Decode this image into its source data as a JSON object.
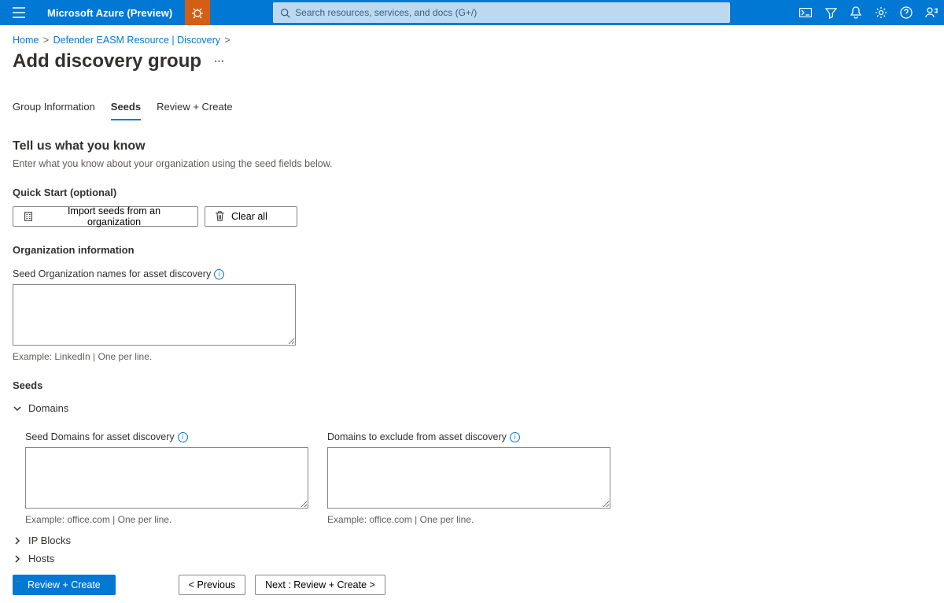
{
  "header": {
    "brand": "Microsoft Azure (Preview)",
    "search_placeholder": "Search resources, services, and docs (G+/)"
  },
  "breadcrumb": {
    "home": "Home",
    "defender": "Defender EASM Resource | Discovery"
  },
  "page": {
    "title": "Add discovery group"
  },
  "tabs": {
    "group_info": "Group Information",
    "seeds": "Seeds",
    "review": "Review + Create"
  },
  "intro": {
    "heading": "Tell us what you know",
    "subtext": "Enter what you know about your organization using the seed fields below."
  },
  "quick_start": {
    "heading": "Quick Start (optional)",
    "import_btn": "Import seeds from an organization",
    "clear_btn": "Clear all"
  },
  "org_info": {
    "heading": "Organization information",
    "label": "Seed Organization names for asset discovery",
    "value": "",
    "helper": "Example: LinkedIn | One per line."
  },
  "seeds": {
    "heading": "Seeds",
    "domains": {
      "title": "Domains",
      "include_label": "Seed Domains for asset discovery",
      "include_value": "",
      "include_helper": "Example: office.com | One per line.",
      "exclude_label": "Domains to exclude from asset discovery",
      "exclude_value": "",
      "exclude_helper": "Example: office.com | One per line."
    },
    "ip_blocks": {
      "title": "IP Blocks"
    },
    "hosts": {
      "title": "Hosts"
    }
  },
  "footer": {
    "review": "Review + Create",
    "previous": "< Previous",
    "next": "Next : Review + Create >"
  }
}
